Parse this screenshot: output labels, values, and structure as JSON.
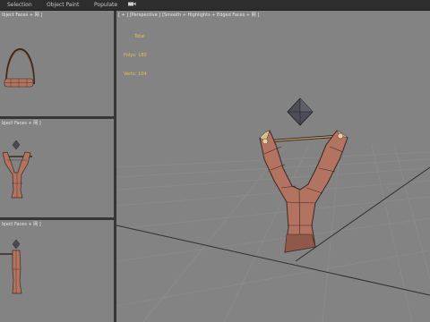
{
  "ribbon": {
    "tabs": [
      {
        "label": "Selection"
      },
      {
        "label": "Object Paint"
      },
      {
        "label": "Populate"
      }
    ],
    "extra_icon": "camera-icon"
  },
  "viewports": {
    "top": {
      "label": "lbject Faces + 网 ]"
    },
    "front": {
      "label": "bject Faces + 网 ]"
    },
    "left": {
      "label": "bject Faces + 网 ]"
    },
    "perspective": {
      "label": "[ + ] [Perspective ] [Smooth + Highlights + Edged Faces + 网 ]",
      "stats": {
        "title": "Total",
        "polys_label": "Polys:",
        "polys_value": "180",
        "verts_label": "Verts:",
        "verts_value": "104"
      }
    }
  },
  "colors": {
    "viewport_bg": "#838383",
    "wood": "#b27460",
    "stats_text": "#e7c24a",
    "ui_dark": "#2d2d2d"
  }
}
